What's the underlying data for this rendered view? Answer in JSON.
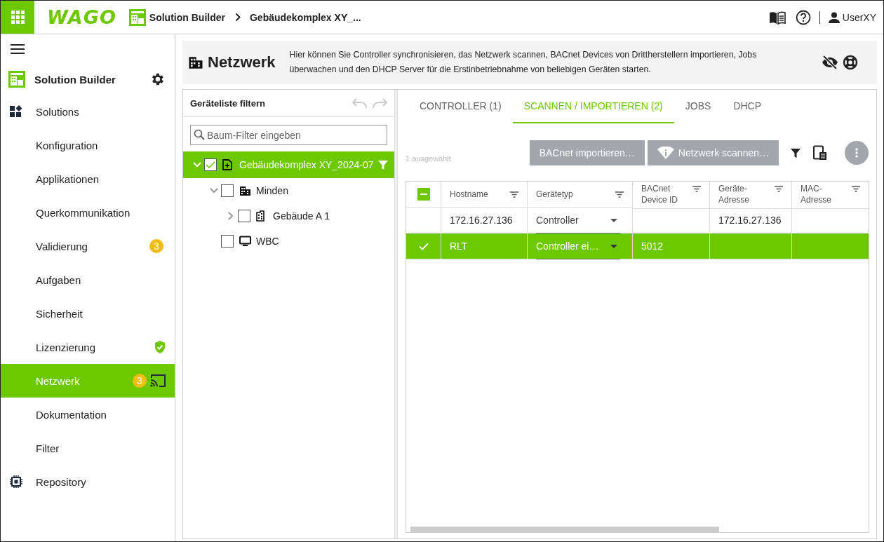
{
  "app_bar": {
    "logo": "WAGO",
    "breadcrumb": [
      {
        "label": "Solution Builder"
      },
      {
        "label": "Gebäudekomplex XY_..."
      }
    ],
    "user": "UserXY"
  },
  "sidebar": {
    "title": "Solution Builder",
    "items": [
      {
        "label": "Solutions",
        "selected": false
      },
      {
        "label": "Konfiguration",
        "selected": false
      },
      {
        "label": "Applikationen",
        "selected": false
      },
      {
        "label": "Querkommunikation",
        "selected": false
      },
      {
        "label": "Validierung",
        "badge": "3",
        "selected": false
      },
      {
        "label": "Aufgaben",
        "selected": false
      },
      {
        "label": "Sicherheit",
        "selected": false
      },
      {
        "label": "Lizenzierung",
        "selected": false
      },
      {
        "label": "Netzwerk",
        "badge": "3",
        "selected": true
      },
      {
        "label": "Dokumentation",
        "selected": false
      },
      {
        "label": "Filter",
        "selected": false
      },
      {
        "label": "Repository",
        "selected": false
      }
    ]
  },
  "page_header": {
    "title": "Netzwerk",
    "description": "Hier können Sie Controller synchronisieren, das Netzwerk scannen, BACnet Devices von Drittherstellern importieren, Jobs überwachen und den DHCP Server für die Erstinbetriebnahme von beliebigen Geräten starten."
  },
  "device_filter": {
    "title": "Geräteliste filtern",
    "search": {
      "placeholder": "Baum-Filter eingeben"
    },
    "tree": [
      {
        "label": "Gebäudekomplex XY_2024-07",
        "checked": true,
        "selected": true,
        "expanded": true,
        "filter_active": true,
        "children": [
          {
            "label": "Minden",
            "checked": false,
            "selected": false,
            "expanded": true,
            "filter_active": false,
            "children": [
              {
                "label": "Gebäude A 1",
                "checked": false,
                "selected": false,
                "expanded": false,
                "filter_active": false
              }
            ]
          },
          {
            "label": "WBC",
            "checked": false,
            "selected": false,
            "filter_active": false
          }
        ]
      }
    ]
  },
  "tabs": [
    {
      "label": "CONTROLLER (1)",
      "selected": false
    },
    {
      "label": "SCANNEN / IMPORTIEREN (2)",
      "selected": true
    },
    {
      "label": "JOBS",
      "selected": false
    },
    {
      "label": "DHCP",
      "selected": false
    }
  ],
  "toolbar": {
    "selection": "1 ausgewählt",
    "buttons": [
      {
        "label": "BACnet importieren…"
      },
      {
        "label": "Netzwerk scannen…"
      }
    ]
  },
  "table": {
    "select_all_indeterminate": true,
    "columns": [
      {
        "label": "Hostname"
      },
      {
        "label": "Gerätetyp"
      },
      {
        "label": "BACnet Device ID"
      },
      {
        "label": "Geräte-Adresse"
      },
      {
        "label": "MAC-Adresse"
      }
    ],
    "rows": [
      {
        "selected": false,
        "hostname": "172.16.27.136",
        "device_type": "Controller",
        "address": "172.16.27.136"
      },
      {
        "selected": true,
        "hostname": "RLT",
        "device_type": "Controller ei…",
        "device_id": "5012"
      }
    ]
  }
}
